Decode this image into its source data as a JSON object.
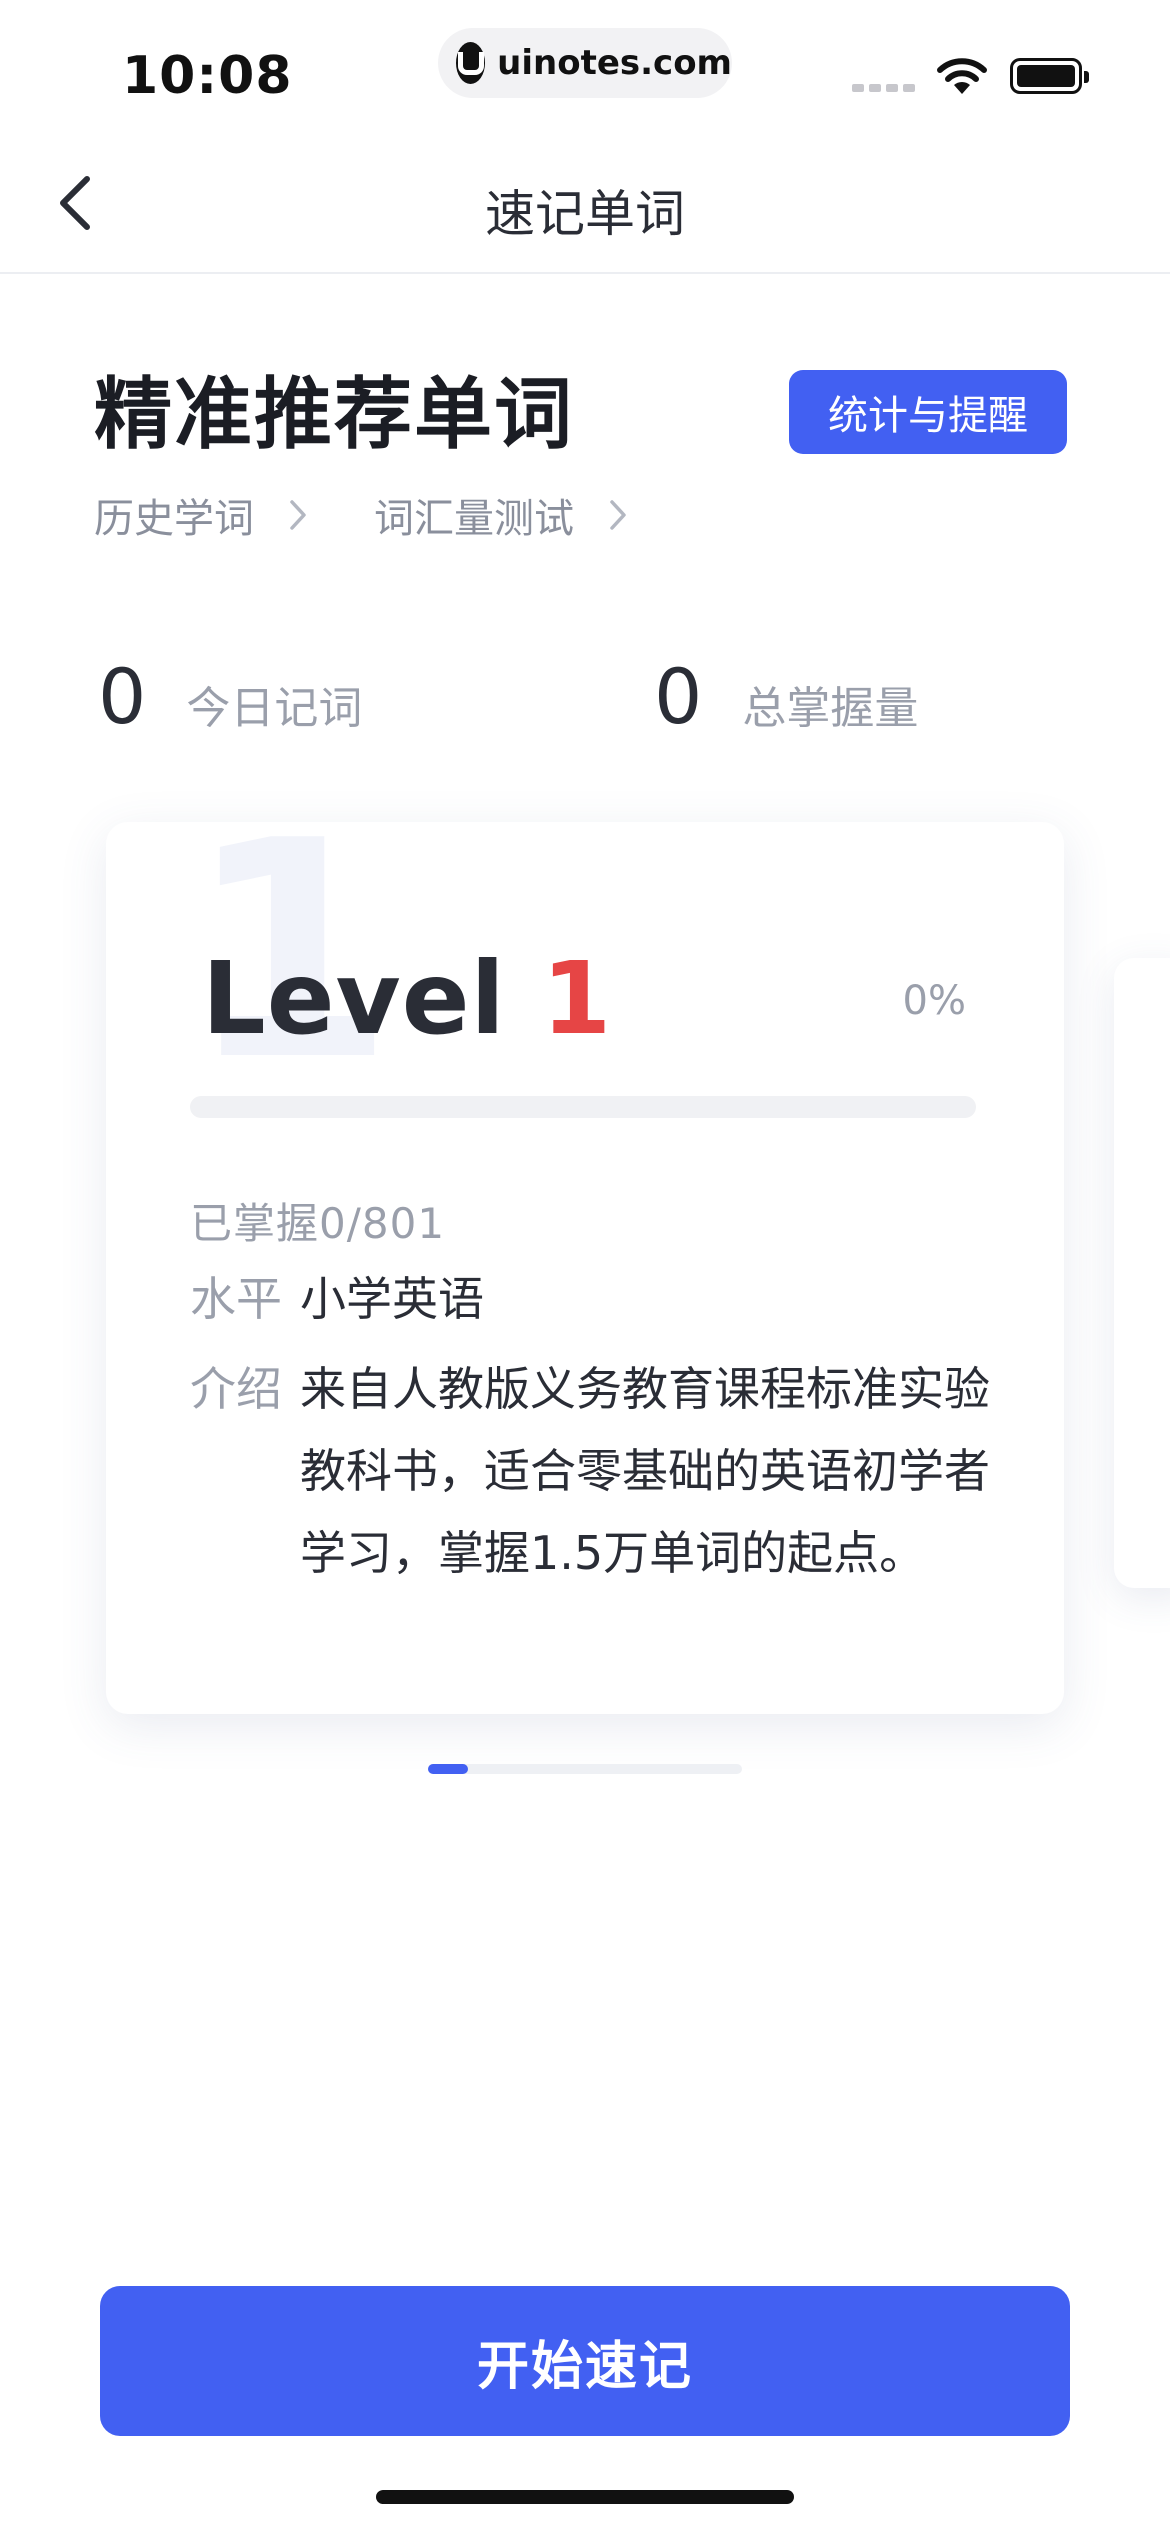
{
  "status_bar": {
    "time": "10:08",
    "url": "uinotes.com"
  },
  "nav": {
    "title": "速记单词",
    "back_icon": "chevron-left-icon"
  },
  "header": {
    "title": "精准推荐单词",
    "stats_button": "统计与提醒",
    "links": [
      {
        "label": "历史学词",
        "icon": "chevron-right-icon"
      },
      {
        "label": "词汇量测试",
        "icon": "chevron-right-icon"
      }
    ]
  },
  "counters": [
    {
      "value": "0",
      "label": "今日记词"
    },
    {
      "value": "0",
      "label": "总掌握量"
    }
  ],
  "card": {
    "level_word": "Level",
    "level_number": "1",
    "percent": "0%",
    "progress": 0,
    "mastered": "已掌握0/801",
    "level_key": "水平",
    "level_value": "小学英语",
    "intro_key": "介绍",
    "intro_value": "来自人教版义务教育课程标准实验教科书，适合零基础的英语初学者学习，掌握1.5万单词的起点。"
  },
  "pager": {
    "active_index": 0
  },
  "bottom": {
    "start_button": "开始速记"
  },
  "colors": {
    "accent": "#4260f2",
    "level_number": "#e64545",
    "muted_text": "#9a9fab"
  }
}
